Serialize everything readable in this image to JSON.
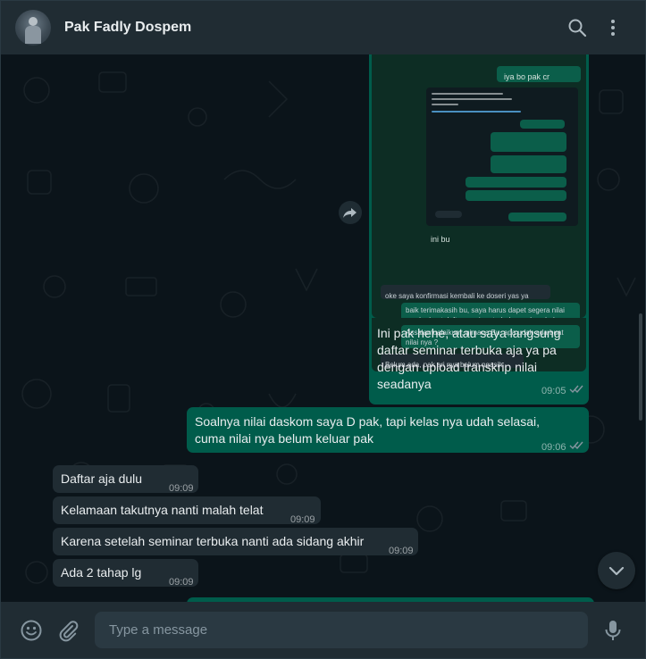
{
  "header": {
    "contact_name": "Pak Fadly Dospem",
    "icons": [
      "search-icon",
      "menu-icon"
    ]
  },
  "quoted_screenshot": {
    "top_message": "iya bo pak cr",
    "caption": "ini bu",
    "msg_1": "oke saya konfirmasi kembali ke doseri yas ya",
    "msg_2": "baik terimakasih bu, saya harus dapet segera nilai nya bu buat daftar seminar terbuka soalnya hehe",
    "msg_3": "Assalamualaikum, gimana Bu, apa udah ada buat nilai nya ?",
    "msg_4": "Belum ada, pak ari nya belum ngasih"
  },
  "messages": [
    {
      "dir": "out",
      "text": "Ini pak hehe, atau saya langsung daftar seminar terbuka aja ya pa dengan upload transkrip nilai seadanya",
      "time": "09:05"
    },
    {
      "dir": "out",
      "text": "Soalnya nilai daskom saya D pak, tapi kelas nya udah selasai, cuma nilai nya belum keluar pak",
      "time": "09:06"
    },
    {
      "dir": "in",
      "text": "Daftar aja dulu",
      "time": "09:09"
    },
    {
      "dir": "in",
      "text": "Kelamaan takutnya nanti malah telat",
      "time": "09:09"
    },
    {
      "dir": "in",
      "text": "Karena setelah seminar terbuka nanti ada sidang akhir",
      "time": "09:09"
    },
    {
      "dir": "in",
      "text": "Ada 2 tahap lg",
      "time": "09:09"
    }
  ],
  "footer": {
    "placeholder": "Type a message",
    "icons": [
      "emoji-icon",
      "attach-icon",
      "mic-icon"
    ]
  },
  "colors": {
    "outgoing": "#005c4b",
    "incoming": "#202c33",
    "header": "#202c33",
    "background": "#0b141a",
    "read_tick": "#53bdeb"
  }
}
